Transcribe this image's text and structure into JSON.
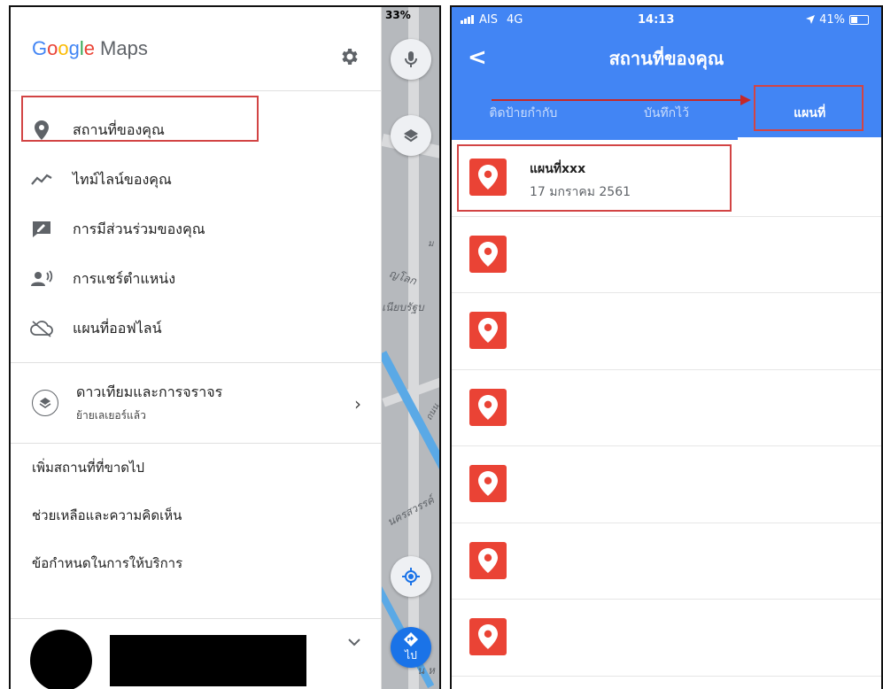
{
  "left": {
    "logo": {
      "letters": [
        "G",
        "o",
        "o",
        "g",
        "l",
        "e"
      ],
      "suffix": "Maps"
    },
    "settings_icon": "gear-icon",
    "menu": [
      {
        "label": "สถานที่ของคุณ",
        "icon": "place-pin-icon",
        "highlighted": true
      },
      {
        "label": "ไทม์ไลน์ของคุณ",
        "icon": "timeline-icon"
      },
      {
        "label": "การมีส่วนร่วมของคุณ",
        "icon": "contributions-icon"
      },
      {
        "label": "การแชร์ตำแหน่ง",
        "icon": "location-sharing-icon"
      },
      {
        "label": "แผนที่ออฟไลน์",
        "icon": "offline-cloud-icon"
      }
    ],
    "layer": {
      "title": "ดาวเทียมและการจราจร",
      "subtitle": "ย้ายเลเยอร์แล้ว",
      "chevron": "›"
    },
    "links": [
      "เพิ่มสถานที่ที่ขาดไป",
      "ช่วยเหลือและความคิดเห็น",
      "ข้อกำหนดในการให้บริการ"
    ],
    "map_strip": {
      "status_battery": "33%",
      "labels": [
        "ญโลก",
        "เนียบรัฐบ",
        "นครสวรรค์",
        "ม",
        "ถนน",
        "น ห"
      ],
      "go_label": "ไป"
    }
  },
  "right": {
    "status": {
      "carrier": "AIS",
      "network": "4G",
      "time": "14:13",
      "battery": "41%",
      "battery_level": 0.41
    },
    "title": "สถานที่ของคุณ",
    "back_label": "<",
    "tabs": [
      {
        "label": "ติดป้ายกำกับ",
        "active": false
      },
      {
        "label": "บันทึกไว้",
        "active": false
      },
      {
        "label": "แผนที่",
        "active": true
      }
    ],
    "items": [
      {
        "name": "แผนที่xxx",
        "date": "17 มกราคม 2561",
        "highlighted": true
      },
      {
        "name": "",
        "date": ""
      },
      {
        "name": "",
        "date": ""
      },
      {
        "name": "",
        "date": ""
      },
      {
        "name": "",
        "date": ""
      },
      {
        "name": "",
        "date": ""
      },
      {
        "name": "",
        "date": ""
      }
    ],
    "accent": "#4285f4",
    "pin_color": "#ea4335",
    "highlight_color": "#d24444"
  }
}
